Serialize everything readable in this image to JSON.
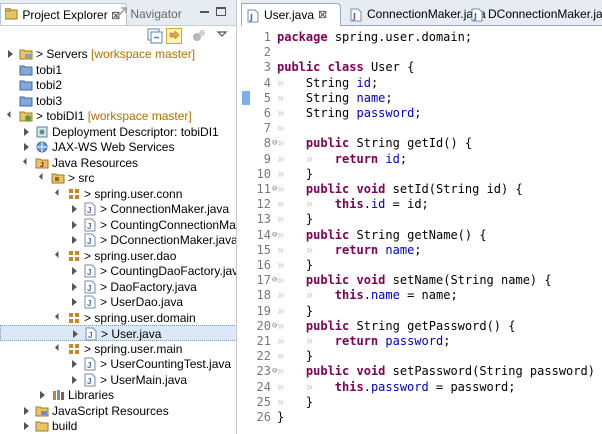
{
  "left_panel": {
    "tabs": [
      {
        "label": "Project Explorer",
        "close": "⊠"
      },
      {
        "label": "Navigator"
      }
    ],
    "tree": [
      {
        "label": "Servers",
        "suffix": "[workspace master]",
        "icon": "server-folder-icon",
        "twisty": "collapsed",
        "level": 0
      },
      {
        "label": "tobi1",
        "icon": "closed-project-icon",
        "twisty": "",
        "level": 0
      },
      {
        "label": "tobi2",
        "icon": "closed-project-icon",
        "twisty": "",
        "level": 0
      },
      {
        "label": "tobi3",
        "icon": "closed-project-icon",
        "twisty": "",
        "level": 0
      },
      {
        "label": "tobiDI1",
        "suffix": "[workspace master]",
        "icon": "web-project-icon",
        "twisty": "expanded",
        "level": 0
      },
      {
        "label": "Deployment Descriptor: tobiDI1",
        "icon": "deployment-descriptor-icon",
        "twisty": "collapsed",
        "level": 1
      },
      {
        "label": "JAX-WS Web Services",
        "icon": "web-services-icon",
        "twisty": "collapsed",
        "level": 1
      },
      {
        "label": "Java Resources",
        "icon": "java-resources-icon",
        "twisty": "expanded",
        "level": 1
      },
      {
        "label": "src",
        "icon": "source-folder-icon",
        "twisty": "expanded",
        "level": 2
      },
      {
        "label": "spring.user.conn",
        "icon": "package-icon",
        "twisty": "expanded",
        "level": 3
      },
      {
        "label": "ConnectionMaker.java",
        "icon": "java-interface-file-icon",
        "twisty": "collapsed",
        "level": 4
      },
      {
        "label": "CountingConnectionMaker.ja",
        "icon": "java-file-icon",
        "twisty": "collapsed",
        "level": 4
      },
      {
        "label": "DConnectionMaker.java",
        "icon": "java-file-icon",
        "twisty": "collapsed",
        "level": 4
      },
      {
        "label": "spring.user.dao",
        "icon": "package-icon",
        "twisty": "expanded",
        "level": 3
      },
      {
        "label": "CountingDaoFactory.java",
        "icon": "java-file-icon",
        "twisty": "collapsed",
        "level": 4
      },
      {
        "label": "DaoFactory.java",
        "icon": "java-file-icon",
        "twisty": "collapsed",
        "level": 4
      },
      {
        "label": "UserDao.java",
        "icon": "java-file-icon",
        "twisty": "collapsed",
        "level": 4
      },
      {
        "label": "spring.user.domain",
        "icon": "package-icon",
        "twisty": "expanded",
        "level": 3
      },
      {
        "label": "User.java",
        "icon": "java-file-icon",
        "twisty": "collapsed",
        "level": 4,
        "selected": true
      },
      {
        "label": "spring.user.main",
        "icon": "package-icon",
        "twisty": "expanded",
        "level": 3
      },
      {
        "label": "UserCountingTest.java",
        "icon": "java-file-icon",
        "twisty": "collapsed",
        "level": 4
      },
      {
        "label": "UserMain.java",
        "icon": "java-file-icon",
        "twisty": "collapsed",
        "level": 4
      },
      {
        "label": "Libraries",
        "icon": "libraries-icon",
        "twisty": "collapsed",
        "level": 2
      },
      {
        "label": "JavaScript Resources",
        "icon": "javascript-resources-icon",
        "twisty": "collapsed",
        "level": 1
      },
      {
        "label": "build",
        "icon": "folder-icon",
        "twisty": "collapsed",
        "level": 1
      }
    ]
  },
  "editor": {
    "tabs": [
      {
        "label": "User.java",
        "close": "⊠",
        "active": true
      },
      {
        "label": "ConnectionMaker.java",
        "active": false
      },
      {
        "label": "DConnectionMaker.java",
        "active": false
      }
    ],
    "lines": [
      {
        "n": "1",
        "fold": "",
        "marker": false,
        "tokens": [
          [
            "kw",
            "package"
          ],
          [
            "ws",
            " "
          ],
          [
            "t",
            "spring.user.domain;"
          ]
        ]
      },
      {
        "n": "2",
        "fold": "",
        "marker": false,
        "tokens": []
      },
      {
        "n": "3",
        "fold": "",
        "marker": false,
        "tokens": [
          [
            "kw",
            "public"
          ],
          [
            "ws",
            " "
          ],
          [
            "kw",
            "class"
          ],
          [
            "ws",
            " "
          ],
          [
            "t",
            "User"
          ],
          [
            "ws",
            " "
          ],
          [
            "t",
            "{"
          ]
        ]
      },
      {
        "n": "4",
        "fold": "",
        "marker": false,
        "tokens": [
          [
            "ws",
            "»   "
          ],
          [
            "t",
            "String"
          ],
          [
            "ws",
            " "
          ],
          [
            "f",
            "id"
          ],
          [
            "t",
            ";"
          ]
        ]
      },
      {
        "n": "5",
        "fold": "",
        "marker": true,
        "tokens": [
          [
            "ws",
            "»   "
          ],
          [
            "t",
            "String"
          ],
          [
            "ws",
            " "
          ],
          [
            "f",
            "name"
          ],
          [
            "t",
            ";"
          ]
        ]
      },
      {
        "n": "6",
        "fold": "",
        "marker": false,
        "tokens": [
          [
            "ws",
            "»   "
          ],
          [
            "t",
            "String"
          ],
          [
            "ws",
            " "
          ],
          [
            "f",
            "password"
          ],
          [
            "t",
            ";"
          ]
        ]
      },
      {
        "n": "7",
        "fold": "",
        "marker": false,
        "tokens": [
          [
            "ws",
            "»   "
          ]
        ]
      },
      {
        "n": "8",
        "fold": "⊖",
        "marker": false,
        "tokens": [
          [
            "ws",
            "»   "
          ],
          [
            "kw",
            "public"
          ],
          [
            "ws",
            " "
          ],
          [
            "t",
            "String"
          ],
          [
            "ws",
            " "
          ],
          [
            "t",
            "getId()"
          ],
          [
            "ws",
            " "
          ],
          [
            "t",
            "{"
          ]
        ]
      },
      {
        "n": "9",
        "fold": "",
        "marker": false,
        "tokens": [
          [
            "ws",
            "»   »   "
          ],
          [
            "kw",
            "return"
          ],
          [
            "ws",
            " "
          ],
          [
            "f",
            "id"
          ],
          [
            "t",
            ";"
          ]
        ]
      },
      {
        "n": "10",
        "fold": "",
        "marker": false,
        "tokens": [
          [
            "ws",
            "»   "
          ],
          [
            "t",
            "}"
          ]
        ]
      },
      {
        "n": "11",
        "fold": "⊖",
        "marker": false,
        "tokens": [
          [
            "ws",
            "»   "
          ],
          [
            "kw",
            "public"
          ],
          [
            "ws",
            " "
          ],
          [
            "kw",
            "void"
          ],
          [
            "ws",
            " "
          ],
          [
            "t",
            "setId(String"
          ],
          [
            "ws",
            " "
          ],
          [
            "t",
            "id)"
          ],
          [
            "ws",
            " "
          ],
          [
            "t",
            "{"
          ]
        ]
      },
      {
        "n": "12",
        "fold": "",
        "marker": false,
        "tokens": [
          [
            "ws",
            "»   »   "
          ],
          [
            "kw",
            "this"
          ],
          [
            "t",
            "."
          ],
          [
            "f",
            "id"
          ],
          [
            "ws",
            " "
          ],
          [
            "t",
            "="
          ],
          [
            "ws",
            " "
          ],
          [
            "t",
            "id;"
          ]
        ]
      },
      {
        "n": "13",
        "fold": "",
        "marker": false,
        "tokens": [
          [
            "ws",
            "»   "
          ],
          [
            "t",
            "}"
          ]
        ]
      },
      {
        "n": "14",
        "fold": "⊖",
        "marker": false,
        "tokens": [
          [
            "ws",
            "»   "
          ],
          [
            "kw",
            "public"
          ],
          [
            "ws",
            " "
          ],
          [
            "t",
            "String"
          ],
          [
            "ws",
            " "
          ],
          [
            "t",
            "getName()"
          ],
          [
            "ws",
            " "
          ],
          [
            "t",
            "{"
          ]
        ]
      },
      {
        "n": "15",
        "fold": "",
        "marker": false,
        "tokens": [
          [
            "ws",
            "»   »   "
          ],
          [
            "kw",
            "return"
          ],
          [
            "ws",
            " "
          ],
          [
            "f",
            "name"
          ],
          [
            "t",
            ";"
          ]
        ]
      },
      {
        "n": "16",
        "fold": "",
        "marker": false,
        "tokens": [
          [
            "ws",
            "»   "
          ],
          [
            "t",
            "}"
          ]
        ]
      },
      {
        "n": "17",
        "fold": "⊖",
        "marker": false,
        "tokens": [
          [
            "ws",
            "»   "
          ],
          [
            "kw",
            "public"
          ],
          [
            "ws",
            " "
          ],
          [
            "kw",
            "void"
          ],
          [
            "ws",
            " "
          ],
          [
            "t",
            "setName(String"
          ],
          [
            "ws",
            " "
          ],
          [
            "t",
            "name)"
          ],
          [
            "ws",
            " "
          ],
          [
            "t",
            "{"
          ]
        ]
      },
      {
        "n": "18",
        "fold": "",
        "marker": false,
        "tokens": [
          [
            "ws",
            "»   »   "
          ],
          [
            "kw",
            "this"
          ],
          [
            "t",
            "."
          ],
          [
            "f",
            "name"
          ],
          [
            "ws",
            " "
          ],
          [
            "t",
            "="
          ],
          [
            "ws",
            " "
          ],
          [
            "t",
            "name;"
          ]
        ]
      },
      {
        "n": "19",
        "fold": "",
        "marker": false,
        "tokens": [
          [
            "ws",
            "»   "
          ],
          [
            "t",
            "}"
          ]
        ]
      },
      {
        "n": "20",
        "fold": "⊖",
        "marker": false,
        "tokens": [
          [
            "ws",
            "»   "
          ],
          [
            "kw",
            "public"
          ],
          [
            "ws",
            " "
          ],
          [
            "t",
            "String"
          ],
          [
            "ws",
            " "
          ],
          [
            "t",
            "getPassword()"
          ],
          [
            "ws",
            " "
          ],
          [
            "t",
            "{"
          ]
        ]
      },
      {
        "n": "21",
        "fold": "",
        "marker": false,
        "tokens": [
          [
            "ws",
            "»   »   "
          ],
          [
            "kw",
            "return"
          ],
          [
            "ws",
            " "
          ],
          [
            "f",
            "password"
          ],
          [
            "t",
            ";"
          ]
        ]
      },
      {
        "n": "22",
        "fold": "",
        "marker": false,
        "tokens": [
          [
            "ws",
            "»   "
          ],
          [
            "t",
            "}"
          ]
        ]
      },
      {
        "n": "23",
        "fold": "⊖",
        "marker": false,
        "tokens": [
          [
            "ws",
            "»   "
          ],
          [
            "kw",
            "public"
          ],
          [
            "ws",
            " "
          ],
          [
            "kw",
            "void"
          ],
          [
            "ws",
            " "
          ],
          [
            "t",
            "setPassword(String"
          ],
          [
            "ws",
            " "
          ],
          [
            "t",
            "password)"
          ],
          [
            "ws",
            " "
          ],
          [
            "t",
            "{"
          ]
        ]
      },
      {
        "n": "24",
        "fold": "",
        "marker": false,
        "tokens": [
          [
            "ws",
            "»   »   "
          ],
          [
            "kw",
            "this"
          ],
          [
            "t",
            "."
          ],
          [
            "f",
            "password"
          ],
          [
            "ws",
            " "
          ],
          [
            "t",
            "="
          ],
          [
            "ws",
            " "
          ],
          [
            "t",
            "password;"
          ]
        ]
      },
      {
        "n": "25",
        "fold": "",
        "marker": false,
        "tokens": [
          [
            "ws",
            "»   "
          ],
          [
            "t",
            "}"
          ]
        ]
      },
      {
        "n": "26",
        "fold": "",
        "marker": false,
        "tokens": [
          [
            "t",
            "}"
          ]
        ]
      }
    ]
  },
  "colors": {
    "keyword": "#7f0055",
    "field": "#0000c0",
    "line_number": "#787878",
    "whitespace_marker": "#c8c8c8",
    "selection": "#dde8f7",
    "workspace_suffix": "#b07000"
  }
}
